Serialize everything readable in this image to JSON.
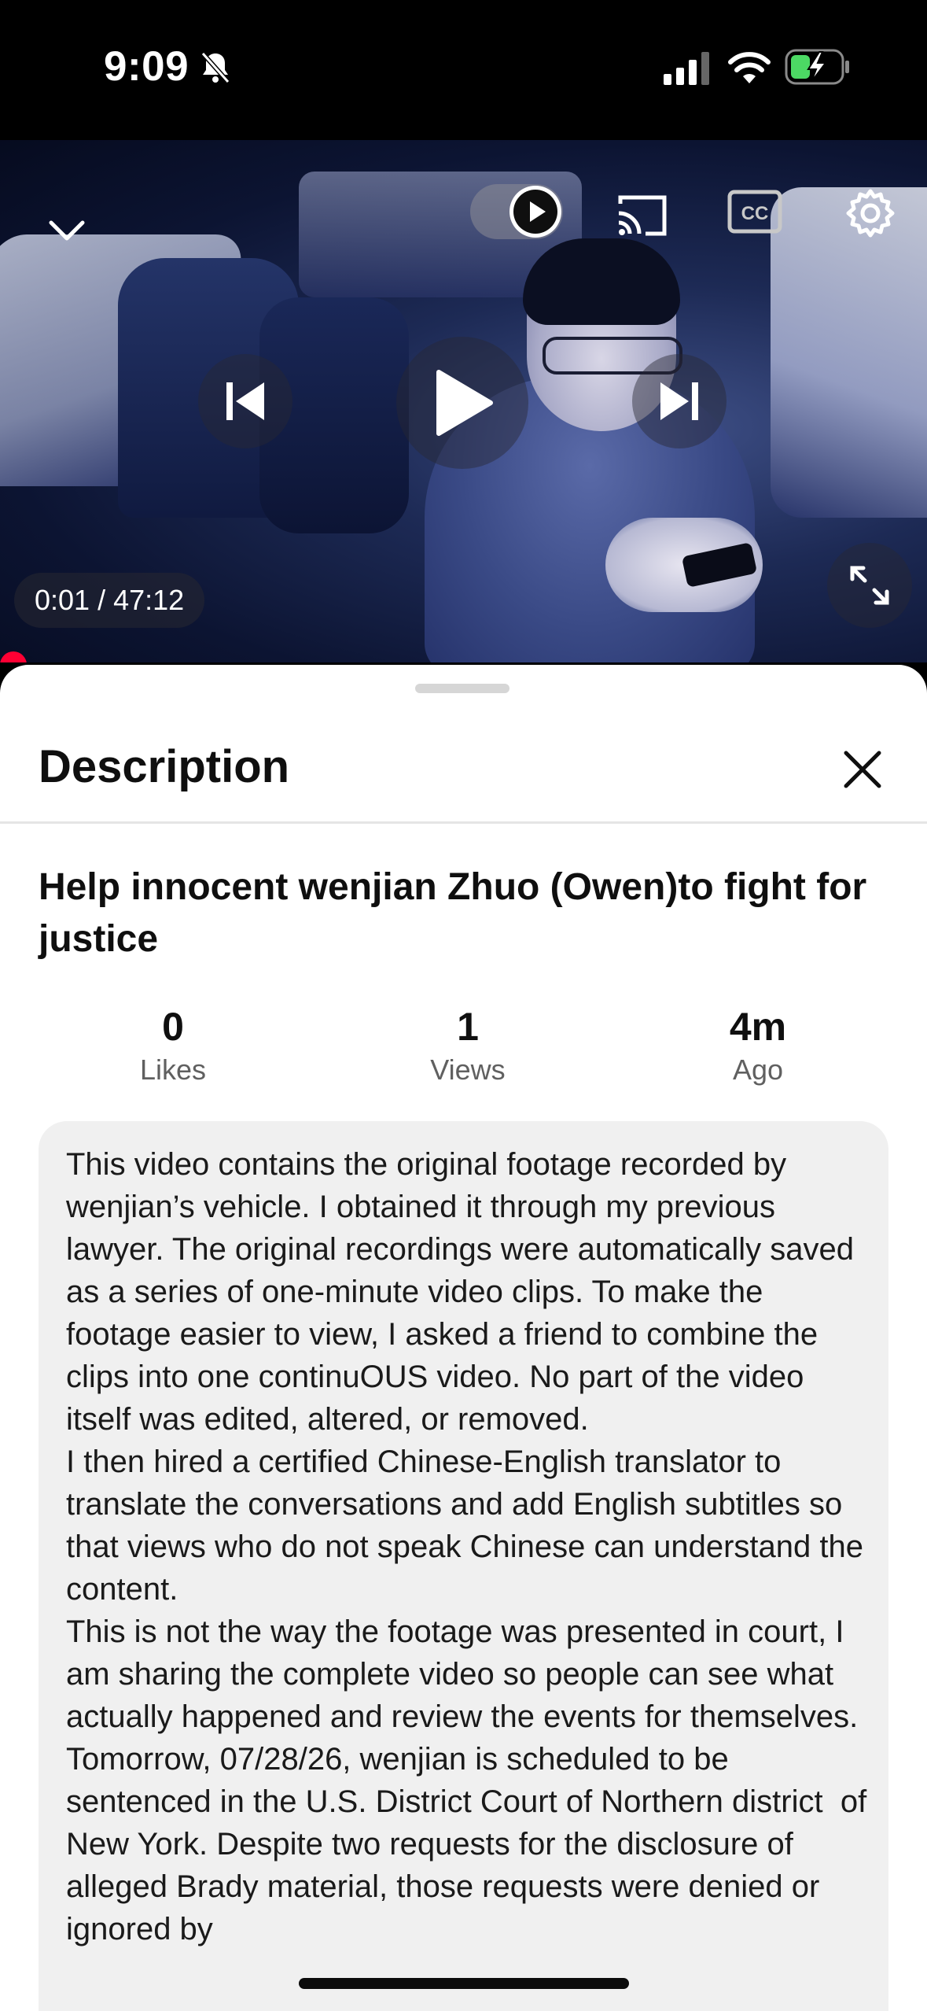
{
  "status_bar": {
    "time": "9:09",
    "icons": [
      "bell-slash-icon",
      "cellular-signal-icon",
      "wifi-icon",
      "battery-charging-icon"
    ]
  },
  "player": {
    "current_time": "0:01",
    "duration": "47:12",
    "time_display": "0:01 / 47:12",
    "progress_fraction": 0.0004,
    "controls": [
      "chevron-down-icon",
      "autoplay-toggle",
      "cast-icon",
      "cc-icon",
      "gear-icon",
      "previous-icon",
      "play-icon",
      "next-icon",
      "fullscreen-icon"
    ],
    "accent_color": "#ff0033"
  },
  "description_panel": {
    "heading": "Description",
    "video_title": "Help innocent wenjian Zhuo (Owen)to fight for justice",
    "stats": [
      {
        "value": "0",
        "label": "Likes"
      },
      {
        "value": "1",
        "label": "Views"
      },
      {
        "value": "4m",
        "label": "Ago"
      }
    ],
    "description": "This video contains the original footage recorded by wenjian’s vehicle. I obtained it through my previous lawyer. The original recordings were automatically saved as a series of one-minute video clips. To make the footage easier to view, I asked a friend to combine the clips into one continuOUS video. No part of the video itself was edited, altered, or removed.\nI then hired a certified Chinese-English translator to translate the conversations and add English subtitles so that views who do not speak Chinese can understand the content.\nThis is not the way the footage was presented in court, I am sharing the complete video so people can see what actually happened and review the events for themselves.\nTomorrow, 07/28/26, wenjian is scheduled to be sentenced in the U.S. District Court of Northern district  of New York. Despite two requests for the disclosure of alleged Brady material, those requests were denied or ignored by"
  }
}
